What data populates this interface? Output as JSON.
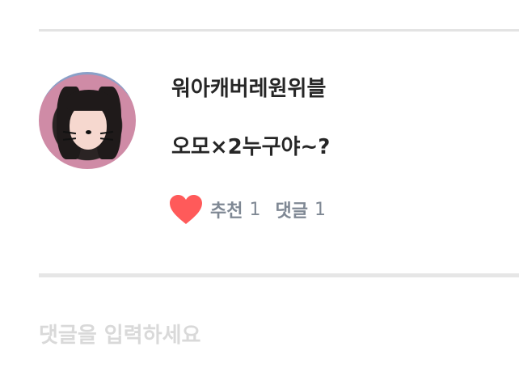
{
  "post": {
    "username": "워아캐버레원위블",
    "text": "오모×2누구야~?",
    "like_label": "추천",
    "like_count": "1",
    "comment_label": "댓글",
    "comment_count": "1",
    "like_icon": "heart-icon",
    "like_color": "#ff5a5a"
  },
  "input": {
    "placeholder": "댓글을 입력하세요"
  }
}
